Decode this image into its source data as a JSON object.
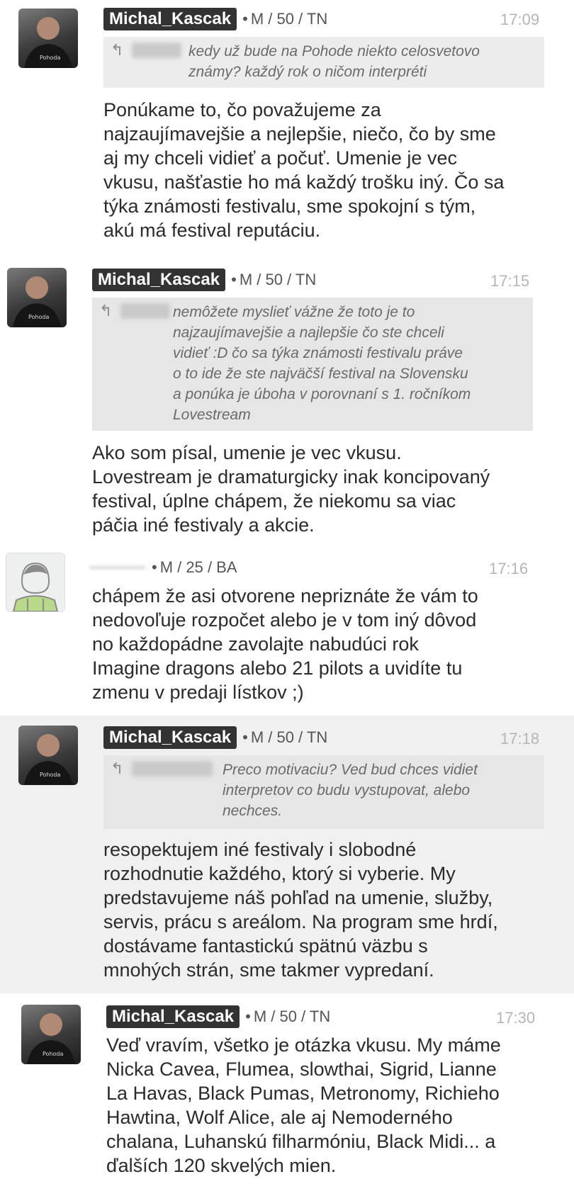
{
  "messages": [
    {
      "author": "Michal_Kascak",
      "meta": "M / 50 / TN",
      "time": "17:09",
      "avatar": "user-photo-avatar",
      "quote": "kedy už bude na Pohode niekto celosvetovo\nznámy? každý rok o ničom interpréti",
      "text": "Ponúkame to, čo považujeme za\nnajzaujímavejšie a nejlepšie, niečo, čo by sme\naj my chceli vidieť a počuť. Umenie je vec\nvkusu, našťastie ho má každý trošku iný. Čo sa\ntýka známosti festivalu, sme spokojní s tým,\nakú má festival reputáciu."
    },
    {
      "author": "Michal_Kascak",
      "meta": "M / 50 / TN",
      "time": "17:15",
      "avatar": "user-photo-avatar",
      "quote": "nemôžete myslieť vážne že toto je to\nnajzaujímavejšie a najlepšie čo ste chceli\nvidieť :D čo sa týka známosti festivalu práve\no to ide že ste najväčší festival na Slovensku\na ponúka je úboha v porovnaní s 1. ročníkom\nLovestream",
      "text": "Ako som písal, umenie je vec vkusu.\nLovestream je dramaturgicky inak koncipovaný\nfestival, úplne chápem, že niekomu sa viac\npáčia iné festivaly a akcie."
    },
    {
      "author": "",
      "meta": "M / 25 / BA",
      "time": "17:16",
      "avatar": "default-user-avatar",
      "text": "chápem že asi otvorene nepriznáte že vám to\nnedovoľuje rozpočet alebo je v tom iný dôvod\nno každopádne zavolajte nabudúci rok\nImagine dragons alebo 21 pilots a uvidíte tu\nzmenu v predaji lístkov ;)"
    },
    {
      "author": "Michal_Kascak",
      "meta": "M / 50 / TN",
      "time": "17:18",
      "avatar": "user-photo-avatar",
      "quote": "Preco motivaciu? Ved bud chces vidiet\ninterpretov co budu vystupovat, alebo\nnechces.",
      "text": "resopektujem iné festivaly i slobodné\nrozhodnutie každého, ktorý si vyberie. My\npredstavujeme náš pohľad na umenie, služby,\nservis, prácu s areálom. Na program sme hrdí,\ndostávame fantastickú spätnú väzbu s\nmnohých strán, sme takmer vypredaní."
    },
    {
      "author": "Michal_Kascak",
      "meta": "M / 50 / TN",
      "time": "17:30",
      "avatar": "user-photo-avatar",
      "text": "Veď vravím, všetko je otázka vkusu. My máme\nNicka Cavea, Flumea, slowthai, Sigrid, Lianne\nLa Havas, Black Pumas, Metronomy, Richieho\nHawtina, Wolf Alice, ale aj Nemoderného\nchalana, Luhanskú filharmóniu, Black Midi... a\nďalších 120 skvelých mien."
    }
  ],
  "icons": {
    "reply": "reply-arrow-icon",
    "avatar_photo": "user-photo-avatar",
    "avatar_default": "default-user-avatar"
  },
  "colors": {
    "nick_bg": "#333333",
    "quote_bg": "#ececec",
    "shade_bg": "#f0f0f0",
    "time": "#b5b5b5"
  }
}
